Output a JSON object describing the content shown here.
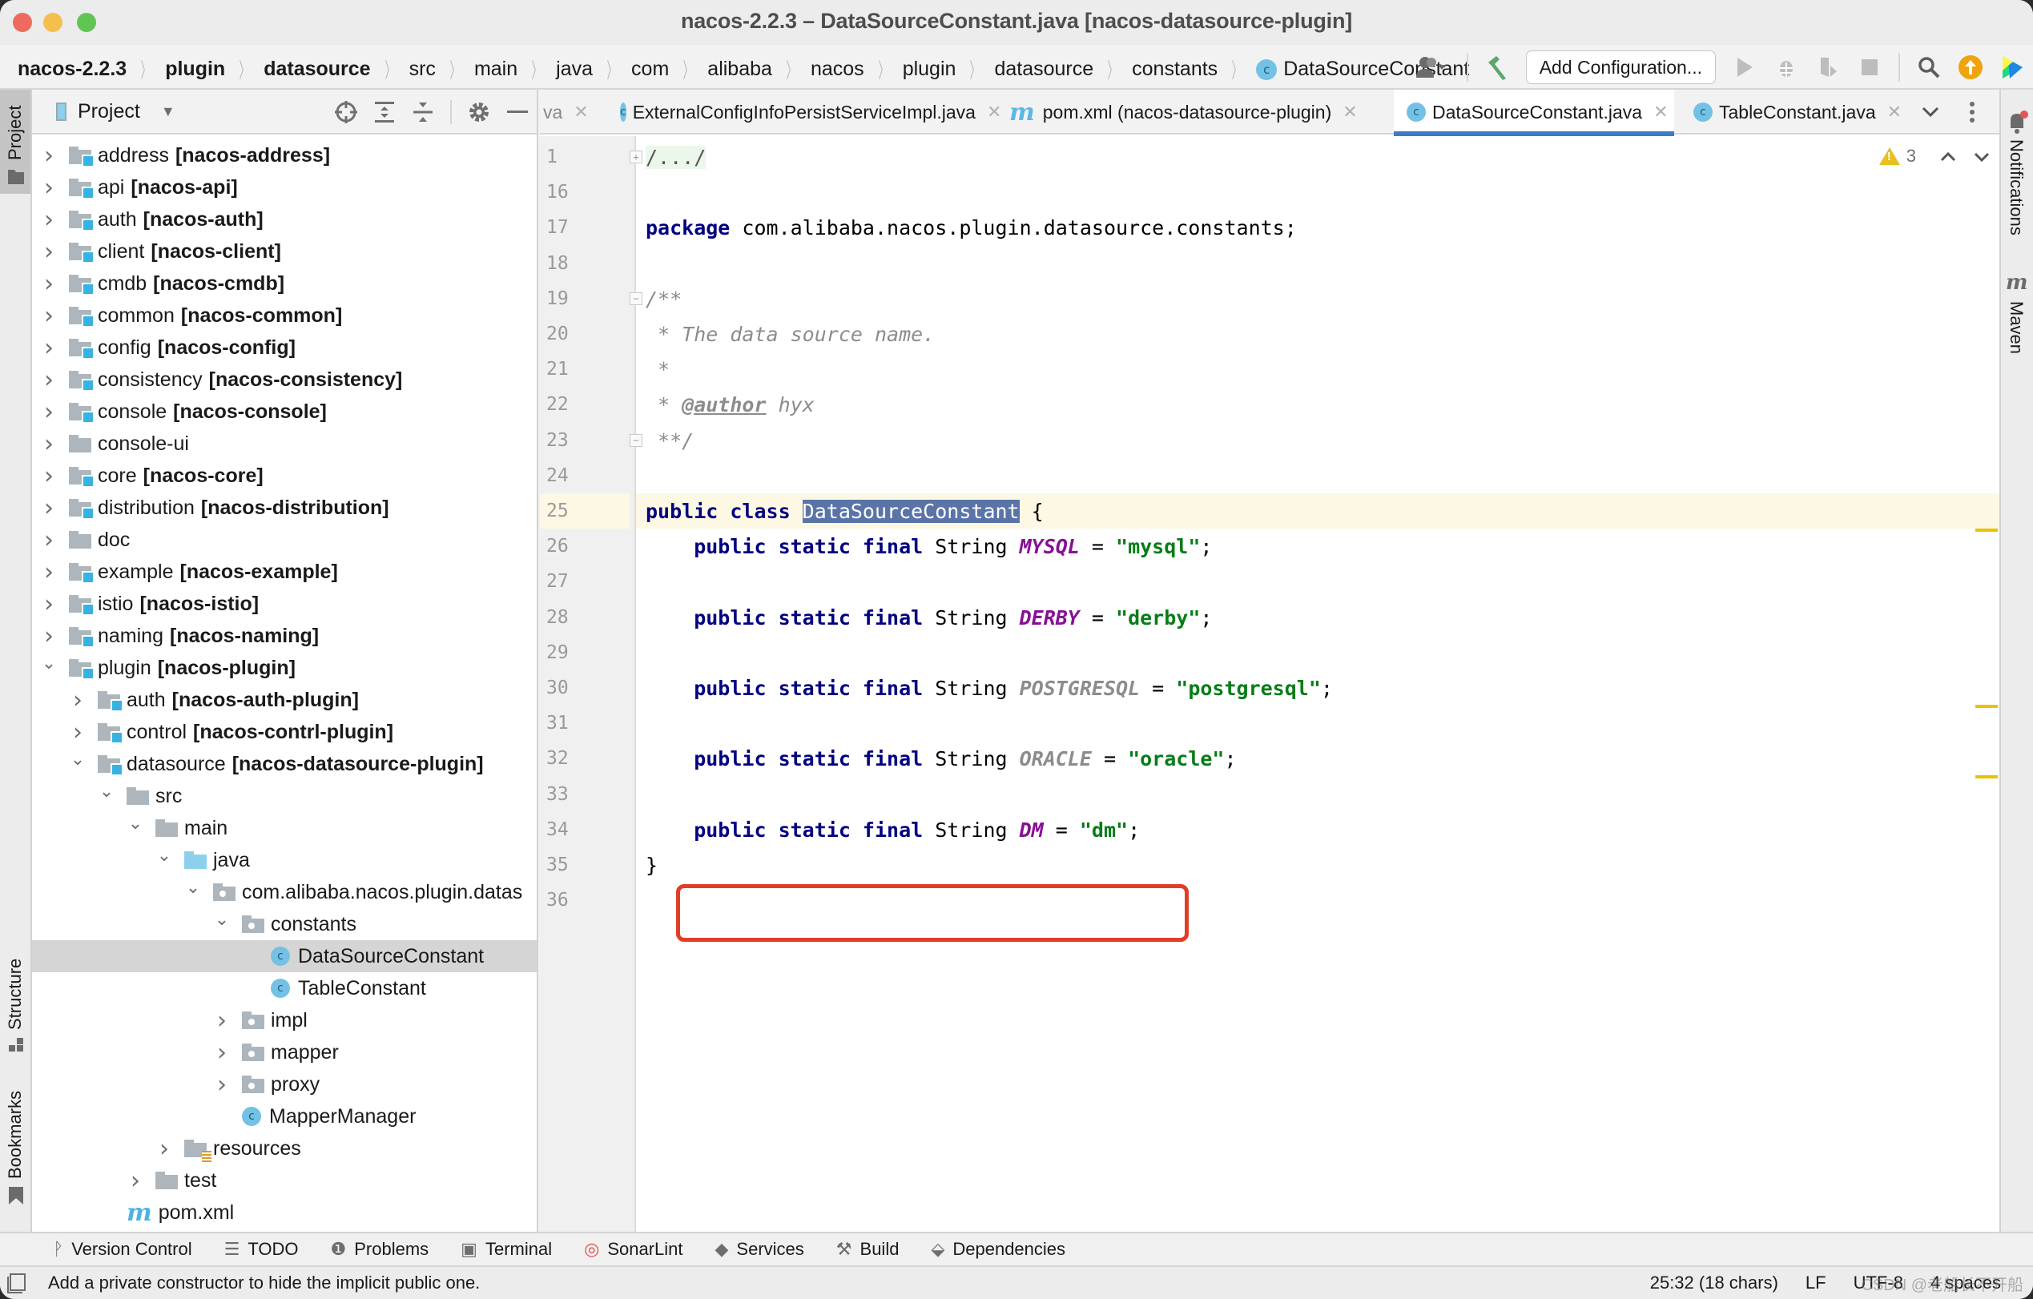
{
  "window": {
    "title": "nacos-2.2.3 – DataSourceConstant.java [nacos-datasource-plugin]"
  },
  "breadcrumb": [
    {
      "label": "nacos-2.2.3",
      "bold": true
    },
    {
      "label": "plugin",
      "bold": true
    },
    {
      "label": "datasource",
      "bold": true
    },
    {
      "label": "src"
    },
    {
      "label": "main"
    },
    {
      "label": "java"
    },
    {
      "label": "com"
    },
    {
      "label": "alibaba"
    },
    {
      "label": "nacos"
    },
    {
      "label": "plugin"
    },
    {
      "label": "datasource"
    },
    {
      "label": "constants"
    },
    {
      "label": "DataSourceConstant",
      "icon": "class-icon"
    }
  ],
  "toolbar": {
    "add_configuration_label": "Add Configuration...",
    "icons": [
      "user-account-icon",
      "build-hammer-icon",
      "run-icon",
      "debug-icon",
      "coverage-icon",
      "stop-icon",
      "search-icon",
      "update-icon",
      "code-with-me-icon"
    ]
  },
  "left_stripe": {
    "project": "Project",
    "structure": "Structure",
    "bookmarks": "Bookmarks"
  },
  "right_stripe": {
    "notifications": "Notifications",
    "maven": "Maven"
  },
  "project_panel": {
    "title": "Project",
    "tree": [
      {
        "name": "address",
        "module": "[nacos-address]",
        "depth": 0,
        "expanded": false,
        "type": "module"
      },
      {
        "name": "api",
        "module": "[nacos-api]",
        "depth": 0,
        "expanded": false,
        "type": "module"
      },
      {
        "name": "auth",
        "module": "[nacos-auth]",
        "depth": 0,
        "expanded": false,
        "type": "module"
      },
      {
        "name": "client",
        "module": "[nacos-client]",
        "depth": 0,
        "expanded": false,
        "type": "module"
      },
      {
        "name": "cmdb",
        "module": "[nacos-cmdb]",
        "depth": 0,
        "expanded": false,
        "type": "module"
      },
      {
        "name": "common",
        "module": "[nacos-common]",
        "depth": 0,
        "expanded": false,
        "type": "module"
      },
      {
        "name": "config",
        "module": "[nacos-config]",
        "depth": 0,
        "expanded": false,
        "type": "module"
      },
      {
        "name": "consistency",
        "module": "[nacos-consistency]",
        "depth": 0,
        "expanded": false,
        "type": "module"
      },
      {
        "name": "console",
        "module": "[nacos-console]",
        "depth": 0,
        "expanded": false,
        "type": "module"
      },
      {
        "name": "console-ui",
        "module": "",
        "depth": 0,
        "expanded": false,
        "type": "folder"
      },
      {
        "name": "core",
        "module": "[nacos-core]",
        "depth": 0,
        "expanded": false,
        "type": "module"
      },
      {
        "name": "distribution",
        "module": "[nacos-distribution]",
        "depth": 0,
        "expanded": false,
        "type": "module"
      },
      {
        "name": "doc",
        "module": "",
        "depth": 0,
        "expanded": false,
        "type": "folder"
      },
      {
        "name": "example",
        "module": "[nacos-example]",
        "depth": 0,
        "expanded": false,
        "type": "module"
      },
      {
        "name": "istio",
        "module": "[nacos-istio]",
        "depth": 0,
        "expanded": false,
        "type": "module"
      },
      {
        "name": "naming",
        "module": "[nacos-naming]",
        "depth": 0,
        "expanded": false,
        "type": "module"
      },
      {
        "name": "plugin",
        "module": "[nacos-plugin]",
        "depth": 0,
        "expanded": true,
        "type": "module"
      },
      {
        "name": "auth",
        "module": "[nacos-auth-plugin]",
        "depth": 1,
        "expanded": false,
        "type": "module"
      },
      {
        "name": "control",
        "module": "[nacos-contrl-plugin]",
        "depth": 1,
        "expanded": false,
        "type": "module"
      },
      {
        "name": "datasource",
        "module": "[nacos-datasource-plugin]",
        "depth": 1,
        "expanded": true,
        "type": "module"
      },
      {
        "name": "src",
        "module": "",
        "depth": 2,
        "expanded": true,
        "type": "folder"
      },
      {
        "name": "main",
        "module": "",
        "depth": 3,
        "expanded": true,
        "type": "folder"
      },
      {
        "name": "java",
        "module": "",
        "depth": 4,
        "expanded": true,
        "type": "source-folder"
      },
      {
        "name": "com.alibaba.nacos.plugin.datas",
        "module": "",
        "depth": 5,
        "expanded": true,
        "type": "package"
      },
      {
        "name": "constants",
        "module": "",
        "depth": 6,
        "expanded": true,
        "type": "package"
      },
      {
        "name": "DataSourceConstant",
        "module": "",
        "depth": 7,
        "type": "class",
        "selected": true
      },
      {
        "name": "TableConstant",
        "module": "",
        "depth": 7,
        "type": "class"
      },
      {
        "name": "impl",
        "module": "",
        "depth": 6,
        "expanded": false,
        "type": "package"
      },
      {
        "name": "mapper",
        "module": "",
        "depth": 6,
        "expanded": false,
        "type": "package"
      },
      {
        "name": "proxy",
        "module": "",
        "depth": 6,
        "expanded": false,
        "type": "package"
      },
      {
        "name": "MapperManager",
        "module": "",
        "depth": 6,
        "type": "class"
      },
      {
        "name": "resources",
        "module": "",
        "depth": 4,
        "expanded": false,
        "type": "resources-folder"
      },
      {
        "name": "test",
        "module": "",
        "depth": 3,
        "expanded": false,
        "type": "folder"
      },
      {
        "name": "pom.xml",
        "module": "",
        "depth": 2,
        "type": "maven"
      }
    ]
  },
  "editor": {
    "tabs": [
      {
        "label": "va",
        "icon": "",
        "active": false
      },
      {
        "label": "ExternalConfigInfoPersistServiceImpl.java",
        "icon": "class-icon",
        "active": false
      },
      {
        "label": "pom.xml (nacos-datasource-plugin)",
        "icon": "maven-icon",
        "active": false
      },
      {
        "label": "DataSourceConstant.java",
        "icon": "class-icon",
        "active": true
      },
      {
        "label": "TableConstant.java",
        "icon": "class-icon",
        "active": false
      }
    ],
    "warnings_count": "3",
    "lines": [
      {
        "num": "1",
        "tokens": [
          {
            "t": "/.../",
            "c": "fold-box"
          }
        ]
      },
      {
        "num": "16",
        "tokens": []
      },
      {
        "num": "17",
        "tokens": [
          {
            "t": "package",
            "c": "kw"
          },
          {
            "t": " com.alibaba.nacos.plugin.datasource.constants;",
            "c": ""
          }
        ]
      },
      {
        "num": "18",
        "tokens": []
      },
      {
        "num": "19",
        "tokens": [
          {
            "t": "/**",
            "c": "cm"
          }
        ]
      },
      {
        "num": "20",
        "tokens": [
          {
            "t": " * The data source name.",
            "c": "cm"
          }
        ]
      },
      {
        "num": "21",
        "tokens": [
          {
            "t": " *",
            "c": "cm"
          }
        ]
      },
      {
        "num": "22",
        "tokens": [
          {
            "t": " * ",
            "c": "cm"
          },
          {
            "t": "@author",
            "c": "tag"
          },
          {
            "t": " hyx",
            "c": "cm"
          }
        ]
      },
      {
        "num": "23",
        "tokens": [
          {
            "t": " **/",
            "c": "cm"
          }
        ]
      },
      {
        "num": "24",
        "tokens": []
      },
      {
        "num": "25",
        "current": true,
        "tokens": [
          {
            "t": "public class ",
            "c": "kw"
          },
          {
            "t": "DataSourceConstant",
            "c": "sel"
          },
          {
            "t": " {",
            "c": ""
          }
        ]
      },
      {
        "num": "26",
        "tokens": [
          {
            "t": "    public static final ",
            "c": "kw"
          },
          {
            "t": "String ",
            "c": ""
          },
          {
            "t": "MYSQL",
            "c": "cst"
          },
          {
            "t": " = ",
            "c": ""
          },
          {
            "t": "\"mysql\"",
            "c": "str"
          },
          {
            "t": ";",
            "c": ""
          }
        ]
      },
      {
        "num": "27",
        "tokens": []
      },
      {
        "num": "28",
        "tokens": [
          {
            "t": "    public static final ",
            "c": "kw"
          },
          {
            "t": "String ",
            "c": ""
          },
          {
            "t": "DERBY",
            "c": "cst"
          },
          {
            "t": " = ",
            "c": ""
          },
          {
            "t": "\"derby\"",
            "c": "str"
          },
          {
            "t": ";",
            "c": ""
          }
        ]
      },
      {
        "num": "29",
        "tokens": []
      },
      {
        "num": "30",
        "tokens": [
          {
            "t": "    public static final ",
            "c": "kw"
          },
          {
            "t": "String ",
            "c": ""
          },
          {
            "t": "POSTGRESQL",
            "c": "cst-unused"
          },
          {
            "t": " = ",
            "c": ""
          },
          {
            "t": "\"postgresql\"",
            "c": "str"
          },
          {
            "t": ";",
            "c": ""
          }
        ]
      },
      {
        "num": "31",
        "tokens": []
      },
      {
        "num": "32",
        "tokens": [
          {
            "t": "    public static final ",
            "c": "kw"
          },
          {
            "t": "String ",
            "c": ""
          },
          {
            "t": "ORACLE",
            "c": "cst-unused"
          },
          {
            "t": " = ",
            "c": ""
          },
          {
            "t": "\"oracle\"",
            "c": "str"
          },
          {
            "t": ";",
            "c": ""
          }
        ]
      },
      {
        "num": "33",
        "tokens": []
      },
      {
        "num": "34",
        "tokens": [
          {
            "t": "    public static final ",
            "c": "kw"
          },
          {
            "t": "String ",
            "c": ""
          },
          {
            "t": "DM",
            "c": "cst"
          },
          {
            "t": " = ",
            "c": ""
          },
          {
            "t": "\"dm\"",
            "c": "str"
          },
          {
            "t": ";",
            "c": ""
          }
        ]
      },
      {
        "num": "35",
        "tokens": [
          {
            "t": "}",
            "c": ""
          }
        ]
      },
      {
        "num": "36",
        "tokens": []
      }
    ]
  },
  "bottom_tools": [
    {
      "label": "Version Control",
      "icon": "version-control-icon",
      "glyph": "ᚹ"
    },
    {
      "label": "TODO",
      "icon": "todo-list-icon",
      "glyph": "☰"
    },
    {
      "label": "Problems",
      "icon": "problems-icon",
      "glyph": "❶"
    },
    {
      "label": "Terminal",
      "icon": "terminal-icon",
      "glyph": "▣"
    },
    {
      "label": "SonarLint",
      "icon": "sonarlint-icon",
      "glyph": "◎"
    },
    {
      "label": "Services",
      "icon": "services-icon",
      "glyph": "◆"
    },
    {
      "label": "Build",
      "icon": "build-icon",
      "glyph": "⚒"
    },
    {
      "label": "Dependencies",
      "icon": "dependencies-icon",
      "glyph": "⬙"
    }
  ],
  "status": {
    "message": "Add a private constructor to hide the implicit public one.",
    "position": "25:32 (18 chars)",
    "line_separator": "LF",
    "encoding": "UTF-8",
    "indent": "4 spaces",
    "watermark": "CSDN @老船长不开船"
  },
  "colors": {
    "accent_tab": "#3d7ac7",
    "highlight_box": "#e03e26",
    "keyword": "#000080",
    "string": "#067d17",
    "constant": "#871094",
    "warning": "#e8c01f"
  }
}
